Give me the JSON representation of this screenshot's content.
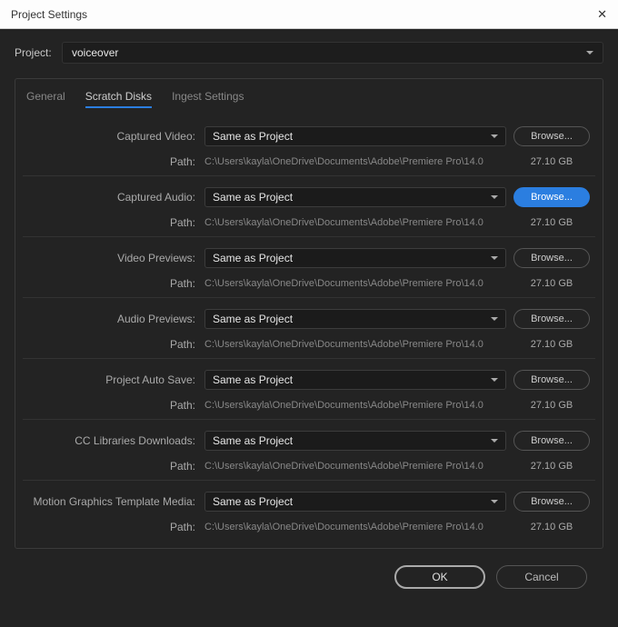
{
  "window": {
    "title": "Project Settings"
  },
  "project": {
    "label": "Project:",
    "value": "voiceover"
  },
  "tabs": [
    "General",
    "Scratch Disks",
    "Ingest Settings"
  ],
  "active_tab": 1,
  "path_label": "Path:",
  "browse_label": "Browse...",
  "sections": [
    {
      "label": "Captured Video:",
      "select": "Same as Project",
      "path": "C:\\Users\\kayla\\OneDrive\\Documents\\Adobe\\Premiere Pro\\14.0",
      "size": "27.10 GB",
      "highlight": false
    },
    {
      "label": "Captured Audio:",
      "select": "Same as Project",
      "path": "C:\\Users\\kayla\\OneDrive\\Documents\\Adobe\\Premiere Pro\\14.0",
      "size": "27.10 GB",
      "highlight": true
    },
    {
      "label": "Video Previews:",
      "select": "Same as Project",
      "path": "C:\\Users\\kayla\\OneDrive\\Documents\\Adobe\\Premiere Pro\\14.0",
      "size": "27.10 GB",
      "highlight": false
    },
    {
      "label": "Audio Previews:",
      "select": "Same as Project",
      "path": "C:\\Users\\kayla\\OneDrive\\Documents\\Adobe\\Premiere Pro\\14.0",
      "size": "27.10 GB",
      "highlight": false
    },
    {
      "label": "Project Auto Save:",
      "select": "Same as Project",
      "path": "C:\\Users\\kayla\\OneDrive\\Documents\\Adobe\\Premiere Pro\\14.0",
      "size": "27.10 GB",
      "highlight": false
    },
    {
      "label": "CC Libraries Downloads:",
      "select": "Same as Project",
      "path": "C:\\Users\\kayla\\OneDrive\\Documents\\Adobe\\Premiere Pro\\14.0",
      "size": "27.10 GB",
      "highlight": false
    },
    {
      "label": "Motion Graphics Template Media:",
      "select": "Same as Project",
      "path": "C:\\Users\\kayla\\OneDrive\\Documents\\Adobe\\Premiere Pro\\14.0",
      "size": "27.10 GB",
      "highlight": false
    }
  ],
  "footer": {
    "ok": "OK",
    "cancel": "Cancel"
  }
}
